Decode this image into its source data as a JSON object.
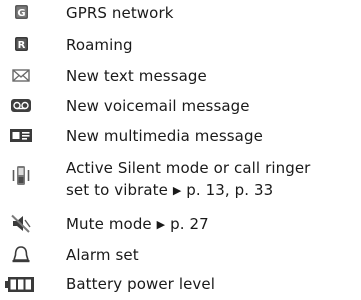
{
  "indicators": [
    {
      "icon": "gprs-network-icon",
      "label": "GPRS network"
    },
    {
      "icon": "roaming-icon",
      "label": "Roaming"
    },
    {
      "icon": "envelope-icon",
      "label": "New text message"
    },
    {
      "icon": "voicemail-icon",
      "label": "New voicemail message"
    },
    {
      "icon": "multimedia-message-icon",
      "label": "New multimedia message"
    },
    {
      "icon": "vibrate-icon",
      "label_line1": "Active Silent mode or call ringer",
      "label_line2": "set to vibrate",
      "refs": "p. 13, p. 33"
    },
    {
      "icon": "mute-speaker-icon",
      "label": "Mute mode",
      "refs": "p. 27"
    },
    {
      "icon": "alarm-bell-icon",
      "label": "Alarm set"
    },
    {
      "icon": "battery-icon",
      "label": "Battery power level"
    }
  ],
  "colors": {
    "icon_dark": "#3a3a3a",
    "icon_mid": "#6a6a6a",
    "text": "#1a1a1a"
  }
}
